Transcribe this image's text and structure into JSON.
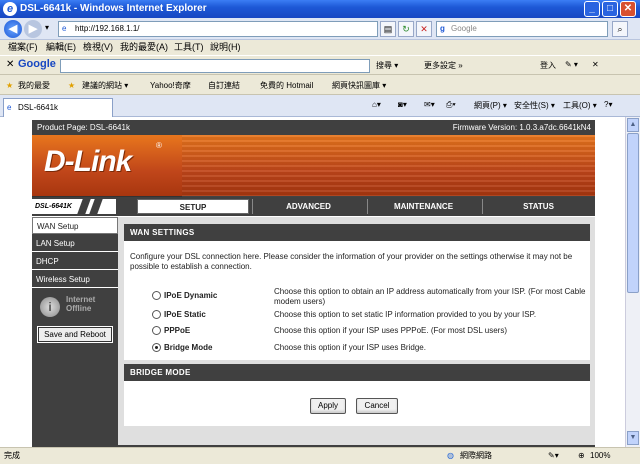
{
  "window": {
    "title": "DSL-6641k - Windows Internet Explorer",
    "minimize": "_",
    "maximize": "□",
    "close": "✕"
  },
  "address": {
    "url": "http://192.168.1.1/",
    "search_placeholder": "Google"
  },
  "menu": [
    "檔案(F)",
    "編輯(E)",
    "檢視(V)",
    "我的最愛(A)",
    "工具(T)",
    "說明(H)"
  ],
  "google_toolbar": {
    "logo": "Google",
    "search_label": "搜尋 ▾",
    "more": "更多設定 »",
    "signin": "登入",
    "tools": "✎ ▾"
  },
  "favorites": {
    "label": "我的最愛",
    "items": [
      "建議的網站 ▾",
      "Yahoo!奇摩",
      "自訂連結",
      "免費的 Hotmail",
      "網頁快訊圖庫 ▾"
    ]
  },
  "tab": {
    "title": "DSL-6641k",
    "tools": [
      "網頁(P) ▾",
      "安全性(S) ▾",
      "工具(O) ▾"
    ]
  },
  "router": {
    "product": "Product Page: DSL-6641k",
    "firmware": "Firmware Version: 1.0.3.a7dc.6641kN4",
    "logo": "D-Link",
    "model": "DSL-6641K",
    "nav_tabs": [
      "SETUP",
      "ADVANCED",
      "MAINTENANCE",
      "STATUS"
    ],
    "sidebar": [
      "WAN Setup",
      "LAN Setup",
      "DHCP",
      "Wireless Setup"
    ],
    "internet_status": "Internet Offline",
    "reboot_button": "Save and Reboot",
    "wan": {
      "heading": "WAN SETTINGS",
      "intro": "Configure your DSL connection here. Please consider the information of your provider on the settings otherwise it may not be possible to establish a connection.",
      "options": [
        {
          "label": "IPoE Dynamic",
          "desc": "Choose this option to obtain an IP address automatically from your ISP. (For most Cable modem users)",
          "selected": false
        },
        {
          "label": "IPoE Static",
          "desc": "Choose this option to set static IP information provided to you by your ISP.",
          "selected": false
        },
        {
          "label": "PPPoE",
          "desc": "Choose this option if your ISP uses PPPoE. (For most DSL users)",
          "selected": false
        },
        {
          "label": "Bridge Mode",
          "desc": "Choose this option if your ISP uses Bridge.",
          "selected": true
        }
      ]
    },
    "bridge": {
      "heading": "BRIDGE MODE",
      "apply": "Apply",
      "cancel": "Cancel"
    }
  },
  "status": {
    "left": "完成",
    "zone": "網際網路",
    "zoom": "100%"
  }
}
